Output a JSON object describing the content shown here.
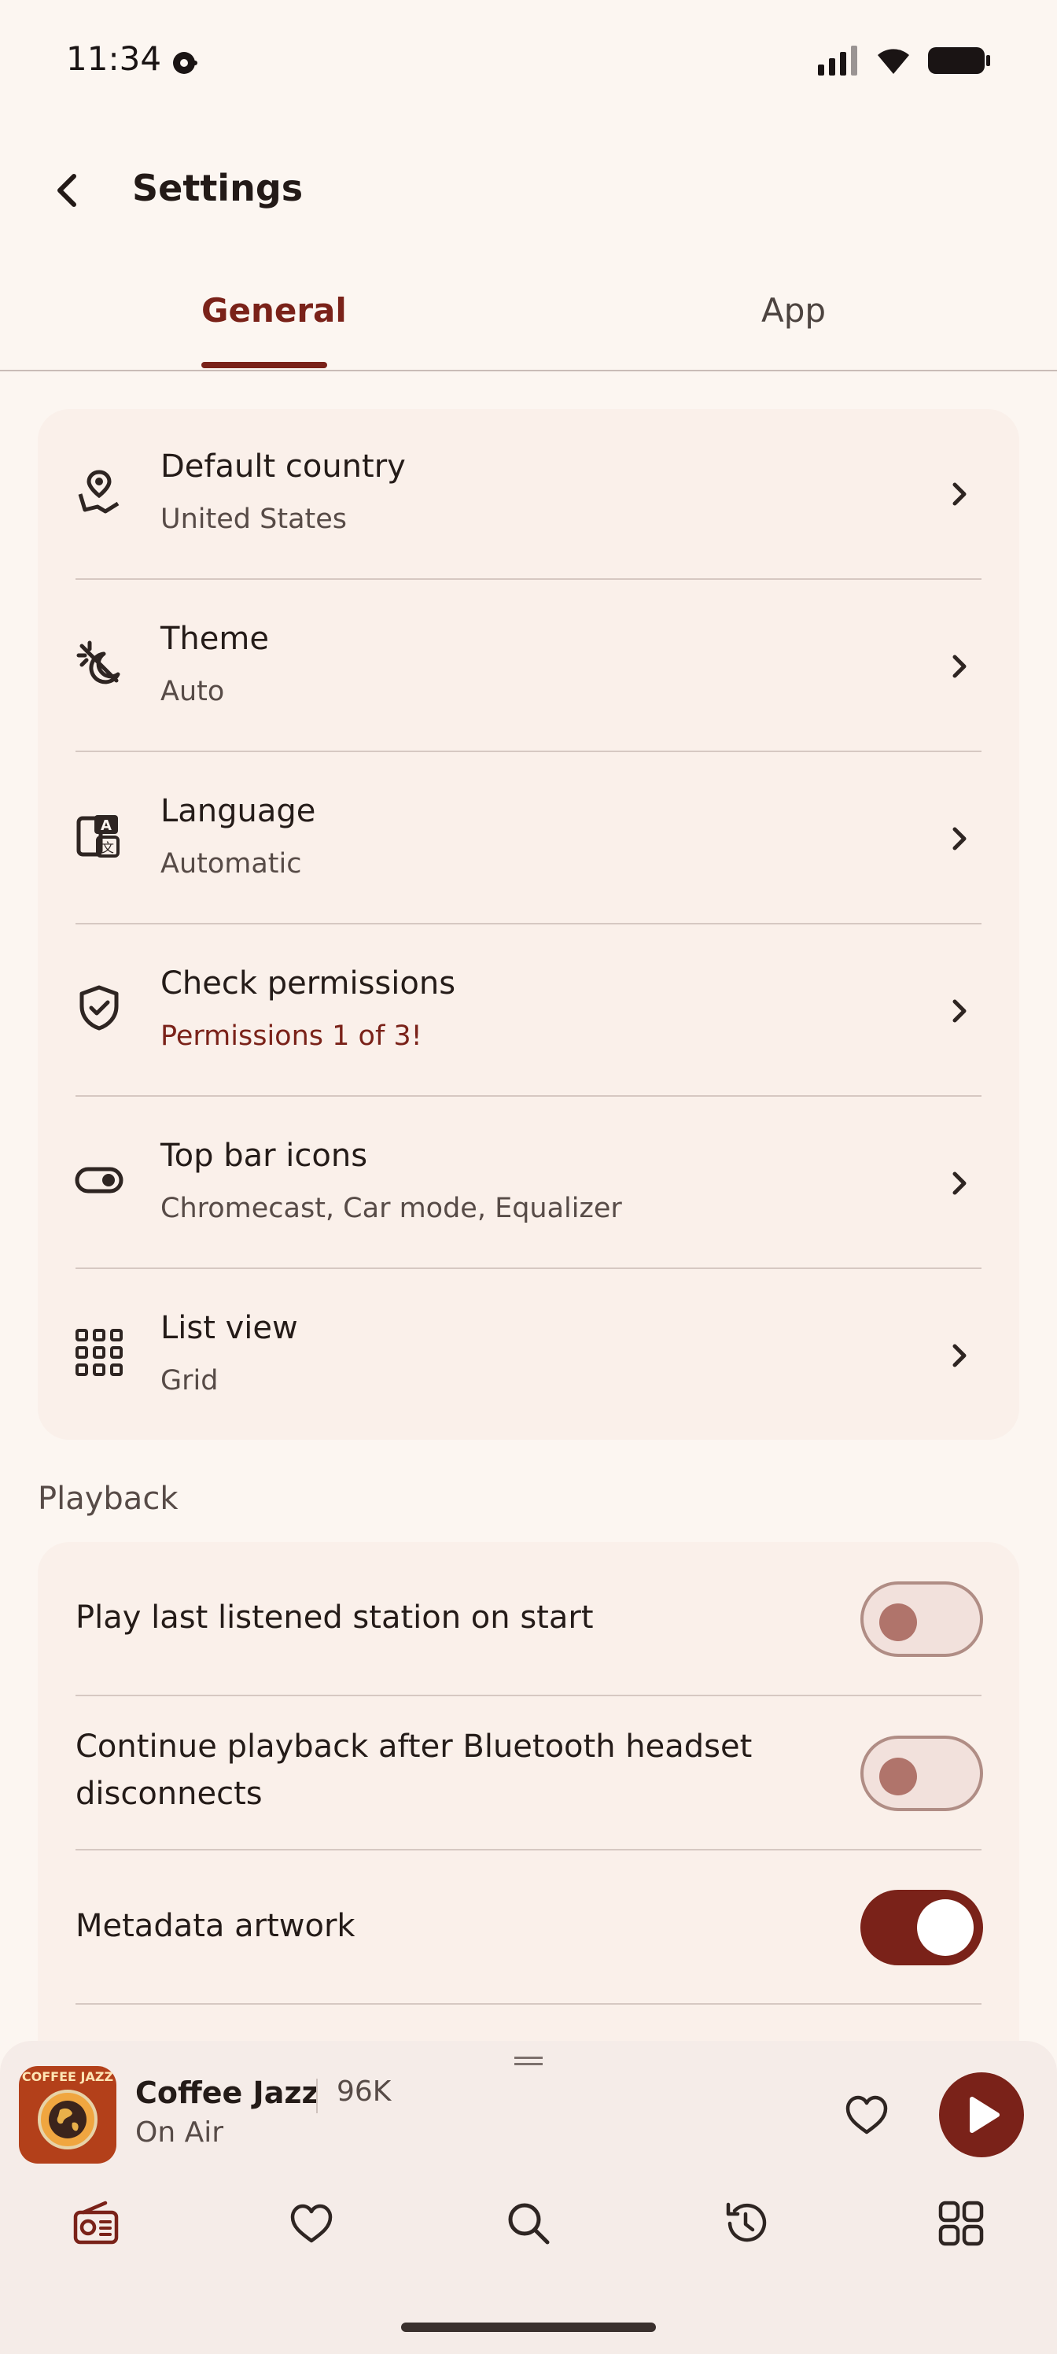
{
  "status": {
    "time": "11:34"
  },
  "header": {
    "title": "Settings"
  },
  "tabs": [
    {
      "label": "General"
    },
    {
      "label": "App"
    }
  ],
  "general": [
    {
      "title": "Default country",
      "subtitle": "United States",
      "icon": "map-pin-icon"
    },
    {
      "title": "Theme",
      "subtitle": "Auto",
      "icon": "theme-icon"
    },
    {
      "title": "Language",
      "subtitle": "Automatic",
      "icon": "translate-icon"
    },
    {
      "title": "Check permissions",
      "subtitle": "Permissions 1 of 3!",
      "icon": "shield-check-icon"
    },
    {
      "title": "Top bar icons",
      "subtitle": "Chromecast, Car mode, Equalizer",
      "icon": "toggle-icon"
    },
    {
      "title": "List view",
      "subtitle": "Grid",
      "icon": "grid-icon"
    }
  ],
  "playback": {
    "section_label": "Playback",
    "items": [
      {
        "label": "Play last listened station on start",
        "enabled": false
      },
      {
        "label": "Continue playback after Bluetooth headset disconnects",
        "enabled": false
      },
      {
        "label": "Metadata artwork",
        "enabled": true
      }
    ]
  },
  "player": {
    "artwork_label": "COFFEE JAZZ",
    "station": "Coffee Jazz",
    "listeners": "96K",
    "status": "On Air"
  },
  "colors": {
    "accent": "#7a2219",
    "background": "#fcf6f1",
    "card": "#faf0ea"
  }
}
